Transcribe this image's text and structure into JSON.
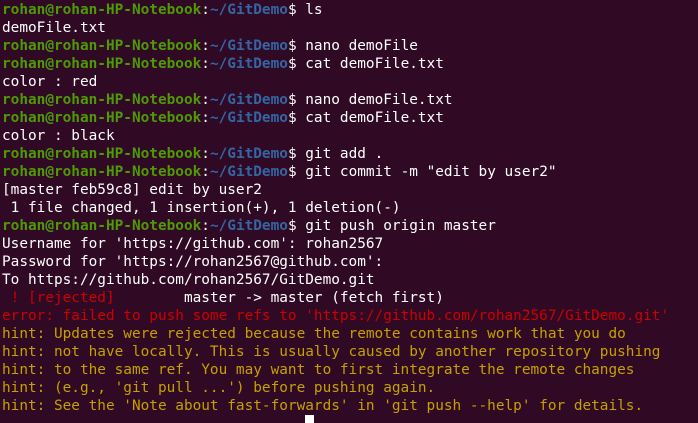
{
  "colors": {
    "background": "#300a24",
    "prompt_user": "#4e9a06",
    "prompt_path": "#3465a4",
    "error": "#cc0000",
    "hint": "#c4a000"
  },
  "prompt": {
    "user_host": "rohan@rohan-HP-Notebook",
    "colon": ":",
    "path": "~/GitDemo",
    "dollar": "$"
  },
  "lines": [
    {
      "type": "prompt",
      "cmd": " ls"
    },
    {
      "type": "out",
      "text": "demoFile.txt"
    },
    {
      "type": "prompt",
      "cmd": " nano demoFile"
    },
    {
      "type": "prompt",
      "cmd": " cat demoFile.txt"
    },
    {
      "type": "out",
      "text": "color : red"
    },
    {
      "type": "prompt",
      "cmd": " nano demoFile.txt"
    },
    {
      "type": "prompt",
      "cmd": " cat demoFile.txt"
    },
    {
      "type": "out",
      "text": "color : black"
    },
    {
      "type": "prompt",
      "cmd": " git add ."
    },
    {
      "type": "prompt",
      "cmd": " git commit -m \"edit by user2\""
    },
    {
      "type": "out",
      "text": "[master feb59c8] edit by user2"
    },
    {
      "type": "out",
      "text": " 1 file changed, 1 insertion(+), 1 deletion(-)"
    },
    {
      "type": "prompt",
      "cmd": " git push origin master"
    },
    {
      "type": "out",
      "text": "Username for 'https://github.com': rohan2567"
    },
    {
      "type": "out",
      "text": "Password for 'https://rohan2567@github.com':"
    },
    {
      "type": "out",
      "text": "To https://github.com/rohan2567/GitDemo.git"
    },
    {
      "type": "rejected",
      "flag": " ! [rejected]",
      "rest": "        master -> master (fetch first)"
    },
    {
      "type": "err",
      "text": "error: failed to push some refs to 'https://github.com/rohan2567/GitDemo.git'"
    },
    {
      "type": "hint",
      "text": "hint: Updates were rejected because the remote contains work that you do"
    },
    {
      "type": "hint",
      "text": "hint: not have locally. This is usually caused by another repository pushing"
    },
    {
      "type": "hint",
      "text": "hint: to the same ref. You may want to first integrate the remote changes"
    },
    {
      "type": "hint",
      "text": "hint: (e.g., 'git pull ...') before pushing again."
    },
    {
      "type": "hint",
      "text": "hint: See the 'Note about fast-forwards' in 'git push --help' for details."
    }
  ]
}
